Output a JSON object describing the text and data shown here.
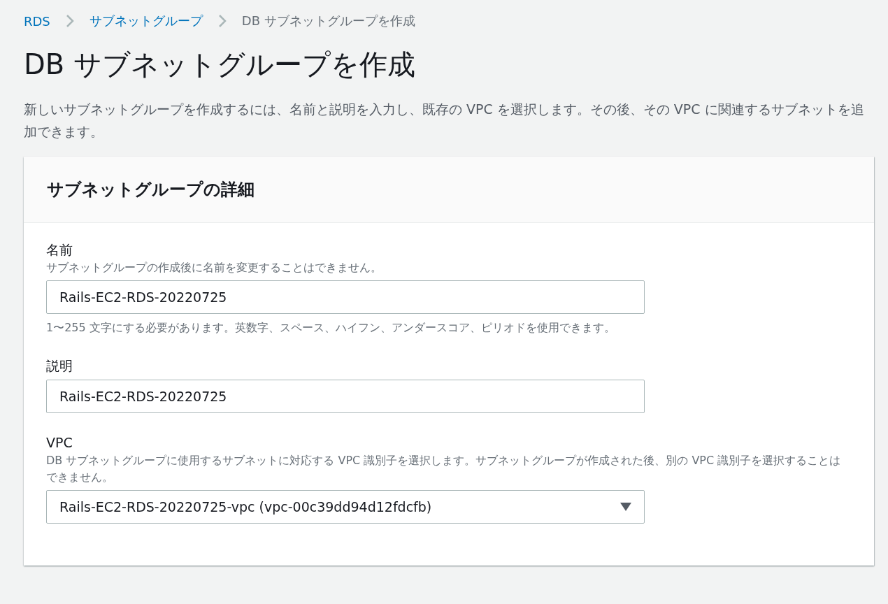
{
  "breadcrumb": [
    {
      "label": "RDS",
      "kind": "link"
    },
    {
      "label": "サブネットグループ",
      "kind": "link"
    },
    {
      "label": "DB サブネットグループを作成",
      "kind": "current"
    }
  ],
  "title": "DB サブネットグループを作成",
  "description": "新しいサブネットグループを作成するには、名前と説明を入力し、既存の VPC を選択します。その後、その VPC に関連するサブネットを追加できます。",
  "panel": {
    "title": "サブネットグループの詳細",
    "fields": [
      {
        "kind": "text",
        "label": "名前",
        "hint": "サブネットグループの作成後に名前を変更することはできません。",
        "value": "Rails-EC2-RDS-20220725",
        "constraint": "1〜255 文字にする必要があります。英数字、スペース、ハイフン、アンダースコア、ピリオドを使用できます。"
      },
      {
        "kind": "text",
        "label": "説明",
        "value": "Rails-EC2-RDS-20220725"
      },
      {
        "kind": "select",
        "label": "VPC",
        "hint": "DB サブネットグループに使用するサブネットに対応する VPC 識別子を選択します。サブネットグループが作成された後、別の VPC 識別子を選択することはできません。",
        "value": "Rails-EC2-RDS-20220725-vpc (vpc-00c39dd94d12fdcfb)"
      }
    ]
  }
}
